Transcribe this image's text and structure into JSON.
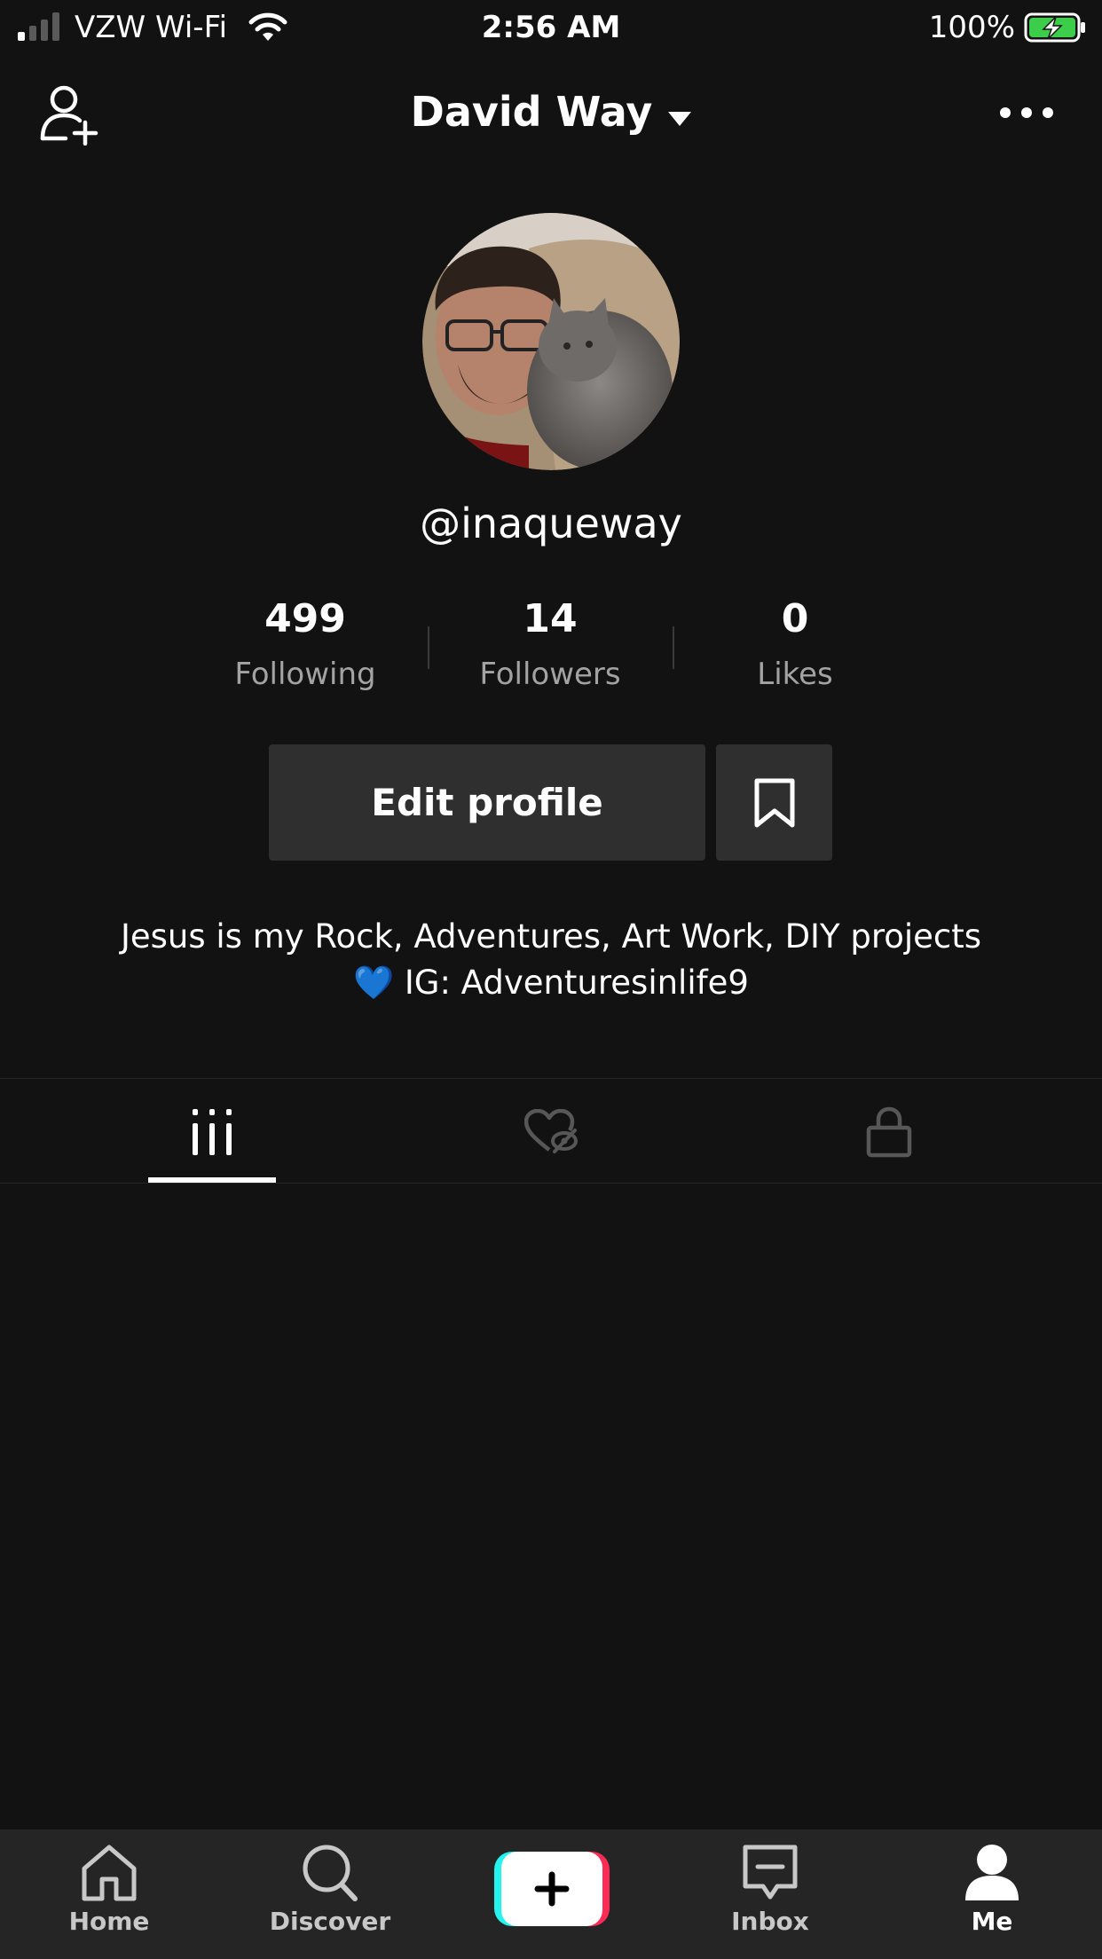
{
  "status_bar": {
    "carrier": "VZW Wi-Fi",
    "time": "2:56 AM",
    "battery": "100%",
    "battery_color": "#3ccd4a"
  },
  "header": {
    "title": "David Way"
  },
  "profile": {
    "username": "@inaqueway",
    "stats": [
      {
        "value": "499",
        "label": "Following"
      },
      {
        "value": "14",
        "label": "Followers"
      },
      {
        "value": "0",
        "label": "Likes"
      }
    ],
    "edit_profile_label": "Edit profile",
    "bio_line1": "Jesus is my Rock, Adventures, Art Work, DIY projects",
    "bio_line2": "💙 IG: Adventuresinlife9"
  },
  "tabs": [
    {
      "icon": "videos-grid-icon",
      "selected": true
    },
    {
      "icon": "liked-hidden-icon",
      "selected": false
    },
    {
      "icon": "lock-icon",
      "selected": false
    }
  ],
  "bottom_nav": [
    {
      "label": "Home",
      "icon": "home-icon"
    },
    {
      "label": "Discover",
      "icon": "search-icon"
    },
    {
      "label": "",
      "icon": "plus-icon"
    },
    {
      "label": "Inbox",
      "icon": "inbox-icon"
    },
    {
      "label": "Me",
      "icon": "person-icon"
    }
  ],
  "colors": {
    "background": "#121212",
    "create_cyan": "#25f4ee",
    "create_pink": "#fe2c55"
  }
}
